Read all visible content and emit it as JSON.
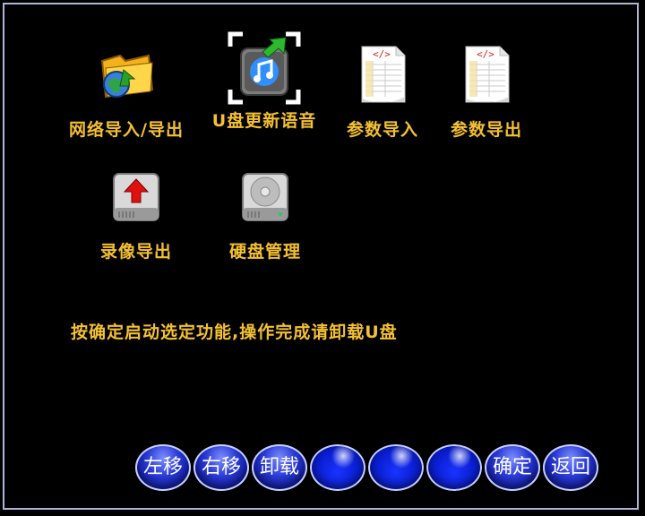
{
  "tiles": [
    {
      "label": "网络导入/导出",
      "icon": "network-folder-icon"
    },
    {
      "label": "U盘更新语音",
      "icon": "music-update-icon"
    },
    {
      "label": "参数导入",
      "icon": "xml-document-icon"
    },
    {
      "label": "参数导出",
      "icon": "xml-document-icon"
    },
    {
      "label": "录像导出",
      "icon": "hdd-export-icon"
    },
    {
      "label": "硬盘管理",
      "icon": "hard-disk-icon"
    }
  ],
  "hint": "按确定启动选定功能,操作完成请卸载U盘",
  "buttons": [
    {
      "label": "左移"
    },
    {
      "label": "右移"
    },
    {
      "label": "卸载"
    },
    {
      "label": ""
    },
    {
      "label": ""
    },
    {
      "label": ""
    },
    {
      "label": "确定"
    },
    {
      "label": "返回"
    }
  ],
  "colors": {
    "label": "#f4c033",
    "frame": "#a9b8d6",
    "button": "#1a2fd0"
  }
}
